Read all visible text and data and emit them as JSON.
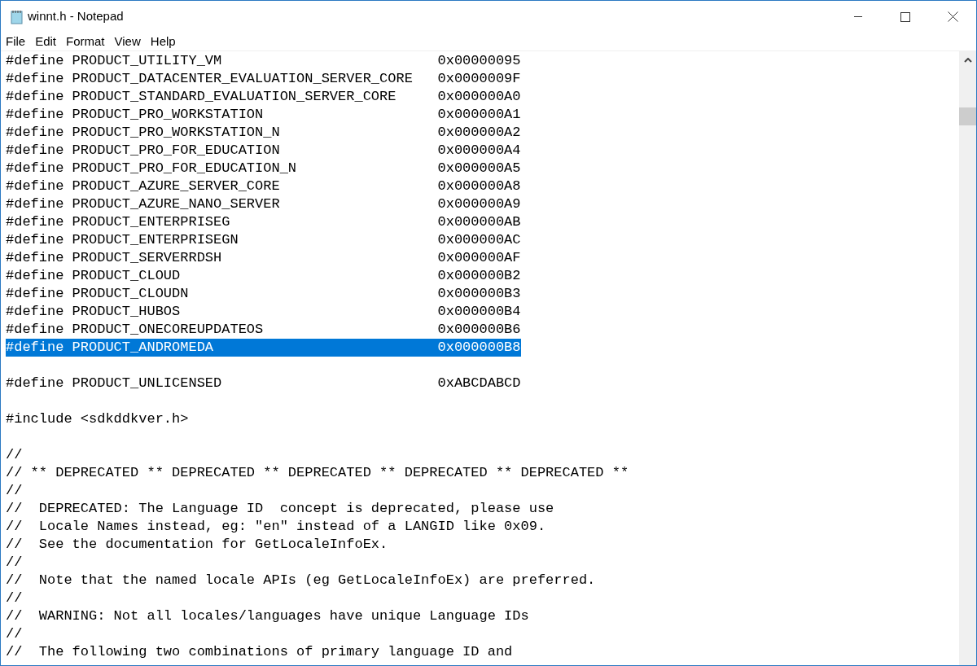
{
  "window": {
    "title": "winnt.h - Notepad"
  },
  "menu": [
    "File",
    "Edit",
    "Format",
    "View",
    "Help"
  ],
  "lines": [
    {
      "kind": "define",
      "name": "#define PRODUCT_UTILITY_VM",
      "value": "0x00000095",
      "selected": false
    },
    {
      "kind": "define",
      "name": "#define PRODUCT_DATACENTER_EVALUATION_SERVER_CORE",
      "value": "0x0000009F",
      "selected": false
    },
    {
      "kind": "define",
      "name": "#define PRODUCT_STANDARD_EVALUATION_SERVER_CORE",
      "value": "0x000000A0",
      "selected": false
    },
    {
      "kind": "define",
      "name": "#define PRODUCT_PRO_WORKSTATION",
      "value": "0x000000A1",
      "selected": false
    },
    {
      "kind": "define",
      "name": "#define PRODUCT_PRO_WORKSTATION_N",
      "value": "0x000000A2",
      "selected": false
    },
    {
      "kind": "define",
      "name": "#define PRODUCT_PRO_FOR_EDUCATION",
      "value": "0x000000A4",
      "selected": false
    },
    {
      "kind": "define",
      "name": "#define PRODUCT_PRO_FOR_EDUCATION_N",
      "value": "0x000000A5",
      "selected": false
    },
    {
      "kind": "define",
      "name": "#define PRODUCT_AZURE_SERVER_CORE",
      "value": "0x000000A8",
      "selected": false
    },
    {
      "kind": "define",
      "name": "#define PRODUCT_AZURE_NANO_SERVER",
      "value": "0x000000A9",
      "selected": false
    },
    {
      "kind": "define",
      "name": "#define PRODUCT_ENTERPRISEG",
      "value": "0x000000AB",
      "selected": false
    },
    {
      "kind": "define",
      "name": "#define PRODUCT_ENTERPRISEGN",
      "value": "0x000000AC",
      "selected": false
    },
    {
      "kind": "define",
      "name": "#define PRODUCT_SERVERRDSH",
      "value": "0x000000AF",
      "selected": false
    },
    {
      "kind": "define",
      "name": "#define PRODUCT_CLOUD",
      "value": "0x000000B2",
      "selected": false
    },
    {
      "kind": "define",
      "name": "#define PRODUCT_CLOUDN",
      "value": "0x000000B3",
      "selected": false
    },
    {
      "kind": "define",
      "name": "#define PRODUCT_HUBOS",
      "value": "0x000000B4",
      "selected": false
    },
    {
      "kind": "define",
      "name": "#define PRODUCT_ONECOREUPDATEOS",
      "value": "0x000000B6",
      "selected": false
    },
    {
      "kind": "define",
      "name": "#define PRODUCT_ANDROMEDA",
      "value": "0x000000B8",
      "selected": true
    },
    {
      "kind": "blank"
    },
    {
      "kind": "define",
      "name": "#define PRODUCT_UNLICENSED",
      "value": "0xABCDABCD",
      "selected": false
    },
    {
      "kind": "blank"
    },
    {
      "kind": "text",
      "text": "#include <sdkddkver.h>"
    },
    {
      "kind": "blank"
    },
    {
      "kind": "text",
      "text": "//"
    },
    {
      "kind": "text",
      "text": "// ** DEPRECATED ** DEPRECATED ** DEPRECATED ** DEPRECATED ** DEPRECATED **"
    },
    {
      "kind": "text",
      "text": "//"
    },
    {
      "kind": "text",
      "text": "//  DEPRECATED: The Language ID  concept is deprecated, please use"
    },
    {
      "kind": "text",
      "text": "//  Locale Names instead, eg: \"en\" instead of a LANGID like 0x09."
    },
    {
      "kind": "text",
      "text": "//  See the documentation for GetLocaleInfoEx."
    },
    {
      "kind": "text",
      "text": "//"
    },
    {
      "kind": "text",
      "text": "//  Note that the named locale APIs (eg GetLocaleInfoEx) are preferred."
    },
    {
      "kind": "text",
      "text": "//"
    },
    {
      "kind": "text",
      "text": "//  WARNING: Not all locales/languages have unique Language IDs"
    },
    {
      "kind": "text",
      "text": "//"
    },
    {
      "kind": "text",
      "text": "//  The following two combinations of primary language ID and"
    }
  ]
}
